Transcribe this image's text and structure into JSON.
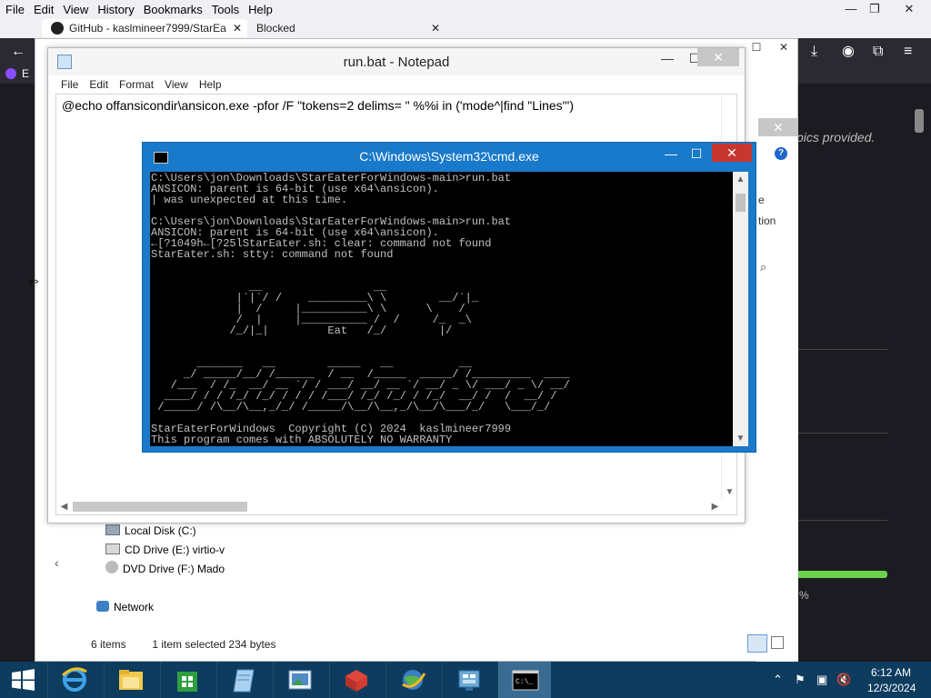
{
  "firefox": {
    "menu": [
      "File",
      "Edit",
      "View",
      "History",
      "Bookmarks",
      "Tools",
      "Help"
    ],
    "tabs": [
      {
        "label": "GitHub - kaslmineer7999/StarEa",
        "close": "✕"
      },
      {
        "label": "Blocked",
        "close": "✕"
      }
    ],
    "new_tab": "+",
    "tab_count": "2",
    "tab_count_chevron": "∨",
    "window_controls": {
      "minimize": "—",
      "maximize": "❐",
      "close": "✕"
    },
    "bookmark_fragment": "E",
    "background_text": "pics provided.",
    "percent_fragment": "%",
    "nav_icons": {
      "back": "←",
      "download": "⤓",
      "account": "◉",
      "extensions": "⧉",
      "menu": "≡"
    }
  },
  "explorer": {
    "title_controls": {
      "minimize": "—",
      "maximize": "☐",
      "close": "✕"
    },
    "detail_fragments": [
      "e",
      "tion"
    ],
    "tree": [
      {
        "label": "Local Disk (C:)",
        "icon": "drive-icon"
      },
      {
        "label": "CD Drive (E:) virtio-v",
        "icon": "cd-drive-icon"
      },
      {
        "label": "DVD Drive (F:) Mado",
        "icon": "dvd-drive-icon"
      },
      {
        "label": "Network",
        "icon": "network-icon"
      }
    ],
    "status": {
      "items": "6 items",
      "selected": "1 item selected  234 bytes"
    },
    "collapse_arrow": "‹",
    "search_glyph": "⌕",
    "help_glyph": "?"
  },
  "notepad": {
    "title": "run.bat - Notepad",
    "menu": [
      "File",
      "Edit",
      "Format",
      "View",
      "Help"
    ],
    "content": "@echo offansicondir\\ansicon.exe -pfor /F \"tokens=2 delims= \" %%i in ('mode^|find \"Lines\"')",
    "controls": {
      "minimize": "—",
      "maximize": "☐",
      "close": "✕"
    }
  },
  "cmd": {
    "title": "C:\\Windows\\System32\\cmd.exe",
    "controls": {
      "minimize": "—",
      "maximize": "☐",
      "close": "✕"
    },
    "lines": [
      "C:\\Users\\jon\\Downloads\\StarEaterForWindows-main>run.bat",
      "ANSICON: parent is 64-bit (use x64\\ansicon).",
      "| was unexpected at this time.",
      "",
      "C:\\Users\\jon\\Downloads\\StarEaterForWindows-main>run.bat",
      "ANSICON: parent is 64-bit (use x64\\ansicon).",
      "←[?1049h←[?25lStarEater.sh: clear: command not found",
      "StarEater.sh: stty: command not found",
      "",
      "",
      "               __                 __",
      "             |`|`/ /    _________\\ \\        __/`|_",
      "             |  /     |__________\\ \\      \\    /",
      "             /  |     |__________ /  /     /_  _\\",
      "            /_/|_|         Eat   /_/        |/",
      "",
      "",
      "       _______   __        _____   __          __",
      "     _/ _____/__/ /______  / __  /_____  _____/ /_________  ____",
      "   /___  / /_  __/ __ `/ / ___/ __/ __ `/ __/ _ \\/ ___/ _ \\/ __/",
      "  ____/ / / /_/ /_/ / / / /___/ /_/ /_/ / /_/  __/ /  /  __/ /",
      " /_____/ /\\__/\\__,_/_/ /_____/\\__/\\__,_/\\__/\\___/_/   \\___/_/",
      "",
      "StarEaterForWindows  Copyright (C) 2024  kaslmineer7999",
      "This program comes with ABSOLUTELY NO WARRANTY"
    ]
  },
  "taskbar": {
    "apps": [
      {
        "name": "internet-explorer",
        "active": false
      },
      {
        "name": "file-explorer",
        "active": false
      },
      {
        "name": "store",
        "active": false
      },
      {
        "name": "notepad",
        "active": false
      },
      {
        "name": "photos",
        "active": false
      },
      {
        "name": "red-app",
        "active": false
      },
      {
        "name": "globe-app",
        "active": false
      },
      {
        "name": "control-panel",
        "active": false
      },
      {
        "name": "cmd",
        "active": true
      }
    ],
    "cmd_icon_text": "C:\\_",
    "tray_glyphs": {
      "chevron": "⌃",
      "flag": "⚑",
      "network": "▣",
      "volume": "🔇"
    },
    "time": "6:12 AM",
    "date": "12/3/2024"
  },
  "colors": {
    "taskbar": "#0e3c5f",
    "cmd_frame": "#1979ca",
    "cmd_close": "#c7372f",
    "progress": "#6bd14b"
  }
}
